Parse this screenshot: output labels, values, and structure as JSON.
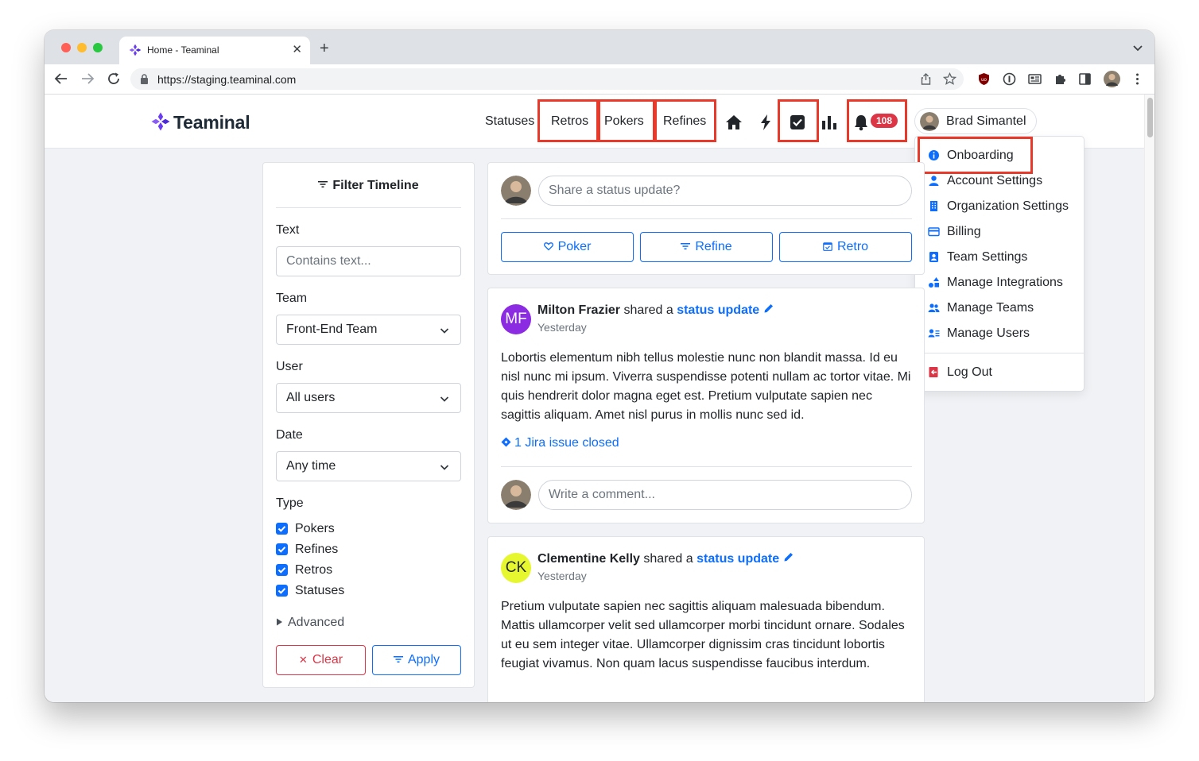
{
  "browser": {
    "tab_title": "Home - Teaminal",
    "url": "https://staging.teaminal.com"
  },
  "navbar": {
    "brand": "Teaminal",
    "links": [
      "Statuses",
      "Retros",
      "Pokers",
      "Refines"
    ],
    "notification_count": "108",
    "user_name": "Brad Simantel"
  },
  "user_menu": {
    "items": [
      {
        "label": "Onboarding",
        "icon": "info-icon"
      },
      {
        "label": "Account Settings",
        "icon": "person-icon"
      },
      {
        "label": "Organization Settings",
        "icon": "building-icon"
      },
      {
        "label": "Billing",
        "icon": "credit-card-icon"
      },
      {
        "label": "Team Settings",
        "icon": "person-badge-icon"
      },
      {
        "label": "Manage Integrations",
        "icon": "shapes-icon"
      },
      {
        "label": "Manage Teams",
        "icon": "people-icon"
      },
      {
        "label": "Manage Users",
        "icon": "person-lines-icon"
      }
    ],
    "logout": "Log Out"
  },
  "filter": {
    "title": "Filter Timeline",
    "text_label": "Text",
    "text_placeholder": "Contains text...",
    "team_label": "Team",
    "team_value": "Front-End Team",
    "user_label": "User",
    "user_value": "All users",
    "date_label": "Date",
    "date_value": "Any time",
    "type_label": "Type",
    "types": [
      "Pokers",
      "Refines",
      "Retros",
      "Statuses"
    ],
    "advanced": "Advanced",
    "clear": "Clear",
    "apply": "Apply"
  },
  "composer": {
    "placeholder": "Share a status update?",
    "poker": "Poker",
    "refine": "Refine",
    "retro": "Retro"
  },
  "posts": [
    {
      "initials": "MF",
      "author": "Milton Frazier",
      "shared": "shared a",
      "link": "status update",
      "time": "Yesterday",
      "body": "Lobortis elementum nibh tellus molestie nunc non blandit massa. Id eu nisl nunc mi ipsum. Viverra suspendisse potenti nullam ac tortor vitae. Mi quis hendrerit dolor magna eget est. Pretium vulputate sapien nec sagittis aliquam. Amet nisl purus in mollis nunc sed id.",
      "jira": "1 Jira issue closed",
      "comment_placeholder": "Write a comment...",
      "avatar_color": "#8b2be2"
    },
    {
      "initials": "CK",
      "author": "Clementine Kelly",
      "shared": "shared a",
      "link": "status update",
      "time": "Yesterday",
      "body": "Pretium vulputate sapien nec sagittis aliquam malesuada bibendum. Mattis ullamcorper velit sed ullamcorper morbi tincidunt ornare. Sodales ut eu sem integer vitae. Ullamcorper dignissim cras tincidunt lobortis feugiat vivamus. Non quam lacus suspendisse faucibus interdum.",
      "avatar_color": "#e6f72f"
    }
  ],
  "colors": {
    "accent": "#0d6efd",
    "danger": "#dc3545",
    "highlight": "#e8392b",
    "brand": "#6b3df2"
  }
}
